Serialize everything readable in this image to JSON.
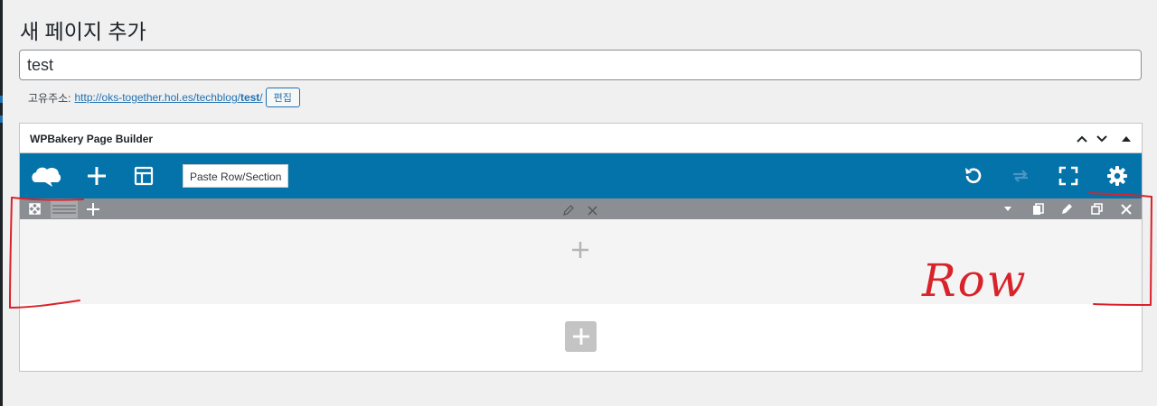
{
  "page": {
    "title": "새 페이지 추가",
    "post_title_value": "test",
    "permalink_label": "고유주소:",
    "permalink_base": "http://oks-together.hol.es/techblog/",
    "permalink_slug": "test",
    "permalink_trail": "/",
    "edit_label": "편집"
  },
  "builder": {
    "title": "WPBakery Page Builder",
    "accent": "#0473aa",
    "paste_label": "Paste Row/Section",
    "toolbar_icons": [
      "logo-icon",
      "add-element-icon",
      "templates-icon",
      "undo-icon",
      "redo-icon",
      "fullscreen-icon",
      "settings-icon"
    ]
  },
  "annotation": {
    "text": "Row",
    "color": "#d8232a"
  }
}
